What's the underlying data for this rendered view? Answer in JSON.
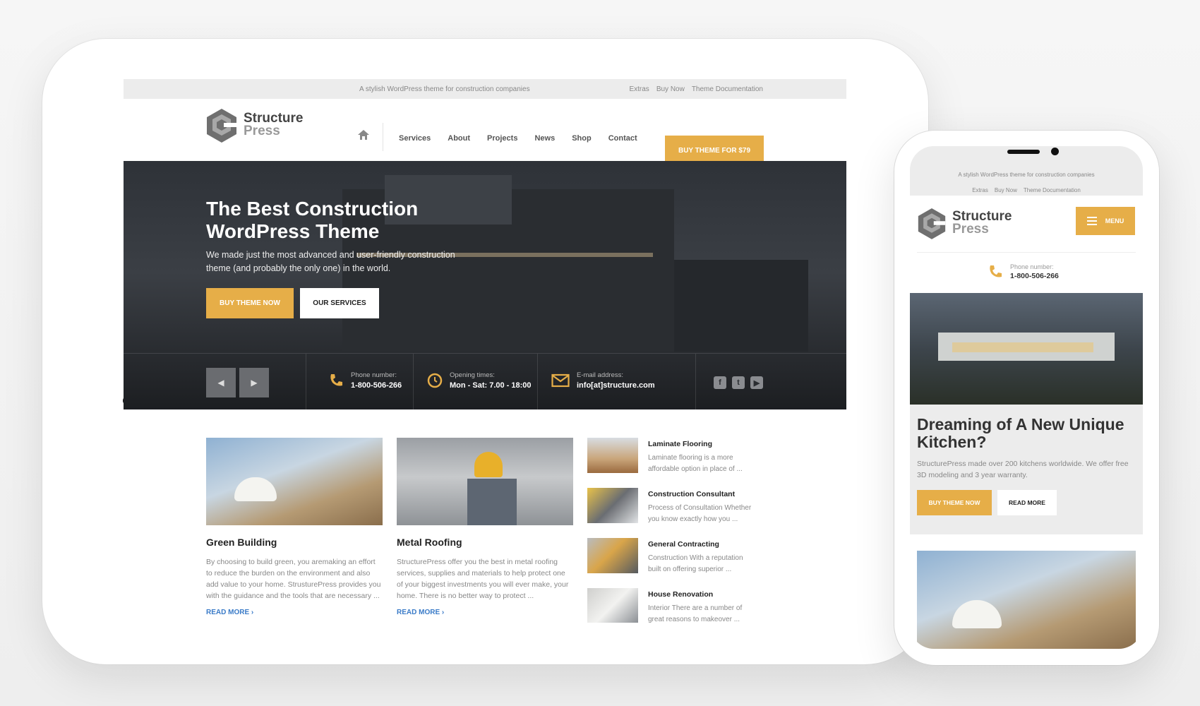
{
  "tablet": {
    "topbar": {
      "tagline": "A stylish WordPress theme for construction companies",
      "links": [
        "Extras",
        "Buy Now",
        "Theme Documentation"
      ]
    },
    "logo": {
      "line1": "Structure",
      "line2": "Press"
    },
    "nav": [
      "Services",
      "About",
      "Projects",
      "News",
      "Shop",
      "Contact"
    ],
    "buy_button": "BUY THEME FOR $79",
    "hero": {
      "title": "The Best Construction WordPress Theme",
      "text": "We made just the most advanced and user-friendly construction theme (and probably the only one) in the world.",
      "primary_button": "BUY THEME NOW",
      "secondary_button": "OUR SERVICES",
      "phone_label": "Phone number:",
      "phone_value": "1-800-506-266",
      "hours_label": "Opening times:",
      "hours_value": "Mon - Sat: 7.00 - 18:00",
      "email_label": "E-mail address:",
      "email_value": "info[at]structure.com"
    },
    "cards": [
      {
        "title": "Green Building",
        "text": "By choosing to build green, you aremaking an effort to reduce the burden on the environment and also add value to your home. StrusturePress provides you with the guidance and the tools that are necessary ...",
        "more": "READ MORE"
      },
      {
        "title": "Metal Roofing",
        "text": "StructurePress offer you the best in metal roofing services, supplies and materials to help protect one of your biggest investments you will ever make, your home. There is no better way to protect ...",
        "more": "READ MORE"
      }
    ],
    "services": [
      {
        "title": "Laminate Flooring",
        "text": "Laminate flooring is a more affordable option in place of ..."
      },
      {
        "title": "Construction Consultant",
        "text": "Process of Consultation Whether you know exactly how you ..."
      },
      {
        "title": "General Contracting",
        "text": "Construction With a reputation built on offering superior ..."
      },
      {
        "title": "House Renovation",
        "text": "Interior There are a number of great reasons to makeover ..."
      }
    ]
  },
  "phone": {
    "topbar": {
      "tagline": "A stylish WordPress theme for construction companies",
      "links": [
        "Extras",
        "Buy Now",
        "Theme Documentation"
      ]
    },
    "menu_label": "MENU",
    "phone_label": "Phone number:",
    "phone_value": "1-800-506-266",
    "promo": {
      "title": "Dreaming of A New Unique Kitchen?",
      "text": "StructurePress made over 200 kitchens worldwide. We offer free 3D modeling and 3 year warranty.",
      "primary_button": "BUY THEME NOW",
      "secondary_button": "READ MORE"
    }
  },
  "colors": {
    "accent": "#e6ae48",
    "link": "#3a7bc8"
  }
}
